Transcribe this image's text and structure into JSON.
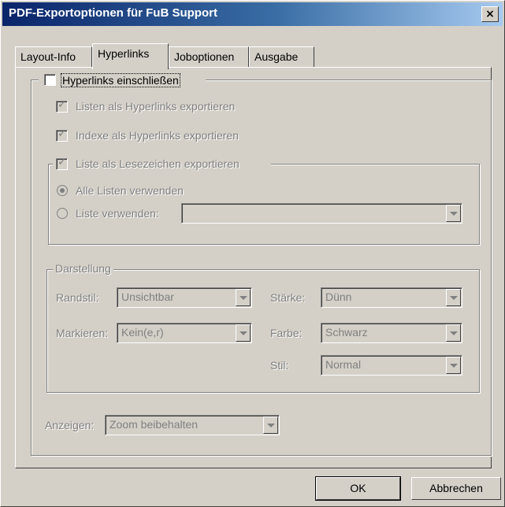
{
  "window": {
    "title": "PDF-Exportoptionen für FuB Support",
    "close_glyph": "×"
  },
  "tabs": [
    {
      "label": "Layout-Info",
      "active": false
    },
    {
      "label": "Hyperlinks",
      "active": true
    },
    {
      "label": "Joboptionen",
      "active": false
    },
    {
      "label": "Ausgabe",
      "active": false
    }
  ],
  "hyperlinks": {
    "include": {
      "label": "Hyperlinks einschließen",
      "checked": false
    },
    "lists_as_hyperlinks": {
      "label": "Listen als Hyperlinks exportieren",
      "checked": true
    },
    "indexes_as_hyperlinks": {
      "label": "Indexe als Hyperlinks exportieren",
      "checked": true
    },
    "list_as_bookmarks": {
      "label": "Liste als Lesezeichen exportieren",
      "checked": true
    },
    "use_all_lists": {
      "label": "Alle Listen verwenden",
      "selected": true
    },
    "use_list": {
      "label": "Liste verwenden:",
      "selected": false,
      "value": ""
    }
  },
  "appearance": {
    "group_label": "Darstellung",
    "border_style": {
      "label": "Randstil:",
      "value": "Unsichtbar"
    },
    "highlight": {
      "label": "Markieren:",
      "value": "Kein(e,r)"
    },
    "width": {
      "label": "Stärke:",
      "value": "Dünn"
    },
    "color": {
      "label": "Farbe:",
      "value": "Schwarz"
    },
    "style": {
      "label": "Stil:",
      "value": "Normal"
    }
  },
  "display": {
    "label": "Anzeigen:",
    "value": "Zoom beibehalten"
  },
  "buttons": {
    "ok": "OK",
    "cancel": "Abbrechen"
  },
  "icons": {
    "close": "close-icon",
    "dropdown": "chevron-down-icon",
    "check": "check-icon"
  },
  "colors": {
    "titlebar_start": "#0a246a",
    "titlebar_end": "#a6caf0",
    "face": "#d4d0c8",
    "disabled_text": "#808080"
  }
}
